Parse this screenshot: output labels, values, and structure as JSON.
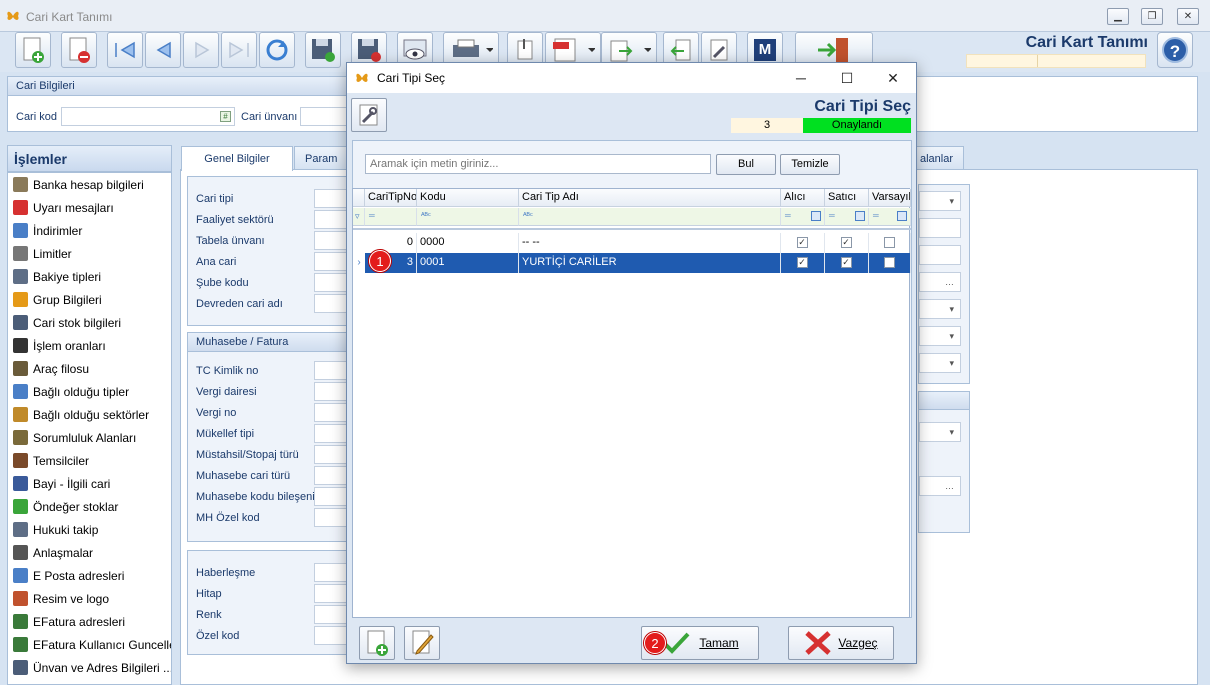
{
  "window": {
    "title": "Cari Kart Tanımı",
    "header_title": "Cari Kart Tanımı"
  },
  "cari_bilgileri": {
    "section": "Cari Bilgileri",
    "cari_kod_label": "Cari kod",
    "cari_unvani_label": "Cari ünvanı"
  },
  "sidebar": {
    "title": "İşlemler",
    "items": [
      {
        "label": "Banka hesap bilgileri",
        "icon": "bank-icon"
      },
      {
        "label": "Uyarı mesajları",
        "icon": "warning-icon"
      },
      {
        "label": "İndirimler",
        "icon": "discount-icon"
      },
      {
        "label": "Limitler",
        "icon": "limit-icon"
      },
      {
        "label": "Bakiye tipleri",
        "icon": "balance-icon"
      },
      {
        "label": "Grup Bilgileri",
        "icon": "group-icon"
      },
      {
        "label": "Cari stok bilgileri",
        "icon": "stock-icon"
      },
      {
        "label": "İşlem oranları",
        "icon": "percent-icon"
      },
      {
        "label": "Araç filosu",
        "icon": "vehicle-icon"
      },
      {
        "label": "Bağlı olduğu tipler",
        "icon": "type-icon"
      },
      {
        "label": "Bağlı olduğu sektörler",
        "icon": "sector-icon"
      },
      {
        "label": "Sorumluluk Alanları",
        "icon": "responsibility-icon"
      },
      {
        "label": "Temsilciler",
        "icon": "person-icon"
      },
      {
        "label": "Bayi - İlgili cari",
        "icon": "dealer-icon"
      },
      {
        "label": "Öndeğer stoklar",
        "icon": "default-stock-icon"
      },
      {
        "label": "Hukuki takip",
        "icon": "legal-icon"
      },
      {
        "label": "Anlaşmalar",
        "icon": "agreement-icon"
      },
      {
        "label": "E Posta adresleri",
        "icon": "email-icon"
      },
      {
        "label": "Resim ve logo",
        "icon": "image-icon"
      },
      {
        "label": "EFatura adresleri",
        "icon": "efatura-icon"
      },
      {
        "label": "EFatura Kullanıcı Guncelle",
        "icon": "efatura-user-icon"
      },
      {
        "label": "Ünvan ve Adres Bilgileri ...",
        "icon": "address-icon"
      }
    ]
  },
  "tabs": {
    "genel": "Genel Bilgiler",
    "param": "Param",
    "alanlar": "alanlar"
  },
  "genel_group": {
    "fields": [
      "Cari tipi",
      "Faaliyet sektörü",
      "Tabela ünvanı",
      "Ana cari",
      "Şube kodu",
      "Devreden cari adı"
    ]
  },
  "muhasebe_group": {
    "title": "Muhasebe / Fatura",
    "fields": [
      "TC Kimlik no",
      "Vergi dairesi",
      "Vergi no",
      "Mükellef tipi",
      "Müstahsil/Stopaj türü",
      "Muhasebe cari türü",
      "Muhasebe kodu bileşeni",
      "MH Özel kod"
    ]
  },
  "iletisim_group": {
    "fields": [
      "Haberleşme",
      "Hitap",
      "Renk",
      "Özel kod"
    ]
  },
  "dialog": {
    "title": "Cari Tipi Seç",
    "header_title": "Cari Tipi Seç",
    "count": "3",
    "status": "Onaylandı",
    "status_color": "#00e020",
    "search_placeholder": "Aramak için metin giriniz...",
    "search_button": "Bul",
    "clear_button": "Temizle",
    "columns": [
      "CariTipNo",
      "Kodu",
      "Cari Tip Adı",
      "Alıcı",
      "Satıcı",
      "Varsayıla"
    ],
    "rows": [
      {
        "no": "0",
        "kodu": "0000",
        "adi": "-- --",
        "alici": true,
        "satici": true,
        "varsayilan": false,
        "selected": false
      },
      {
        "no": "3",
        "kodu": "0001",
        "adi": "YURTİÇİ CARİLER",
        "alici": true,
        "satici": true,
        "varsayilan": false,
        "selected": true
      }
    ],
    "ok_button": "Tamam",
    "cancel_button": "Vazgeç",
    "ok_mnemonic": "T",
    "cancel_mnemonic": "V"
  },
  "annotations": {
    "badge1": "1",
    "badge2": "2"
  }
}
